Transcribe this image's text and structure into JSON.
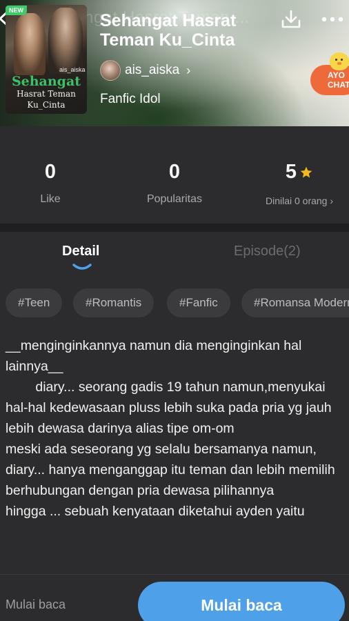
{
  "book": {
    "title": "Sehangat Hasrat Teman Ku_Cinta",
    "ghost_title": "Sehangat Hasrat Teman ...",
    "author": "ais_aiska",
    "genre": "Fanfic Idol",
    "new_badge": "NEW",
    "cover": {
      "author_tag": "ais_aiska",
      "line1": "Sehangat",
      "line2": "Hasrat Teman",
      "line3": "Ku_Cinta"
    }
  },
  "promo": {
    "chat_line1": "AYO",
    "chat_line2": "CHAT"
  },
  "stats": {
    "like": {
      "value": "0",
      "label": "Like"
    },
    "popularity": {
      "value": "0",
      "label": "Popularitas"
    },
    "rating": {
      "value": "5",
      "label": "Dinilai 0 orang ›"
    }
  },
  "tabs": {
    "detail": "Detail",
    "episode": "Episode(2)"
  },
  "tags": [
    "#Teen",
    "#Romantis",
    "#Fanfic",
    "#Romansa Modern"
  ],
  "synopsis": "__menginginkannya namun dia menginginkan hal lainnya__\n        diary... seorang gadis 19 tahun namun,menyukai hal-hal kedewasaan pluss lebih suka pada pria yg jauh lebih dewasa darinya alias tipe om-om\nmeski ada seseorang yg selalu bersamanya namun,\ndiary... hanya menganggap itu teman dan lebih memilih berhubungan dengan pria dewasa pilihannya\nhingga ... sebuah kenyataan diketahui ayden yaitu",
  "bottom": {
    "left_label": "Mulai baca",
    "read_button": "Mulai baca"
  },
  "colors": {
    "accent": "#4ea0e9",
    "star": "#f5b81c",
    "background": "#2c2c2e",
    "new_badge": "#3fc96a",
    "chat": "#ee6a3a"
  }
}
